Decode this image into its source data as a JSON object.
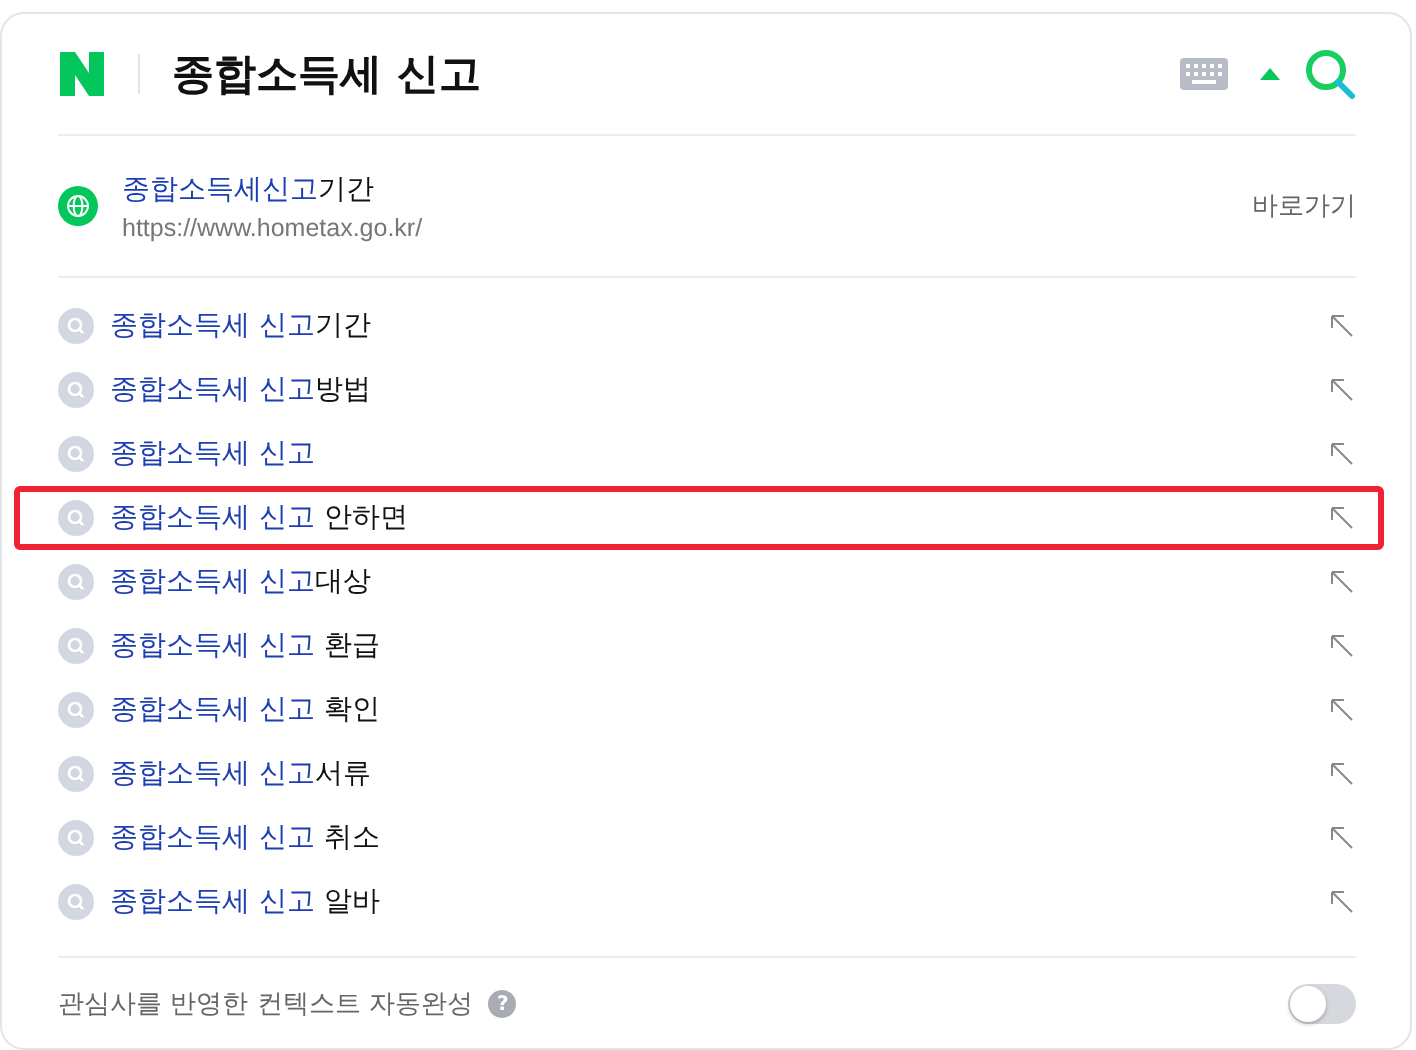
{
  "header": {
    "query": "종합소득세 신고"
  },
  "site_result": {
    "highlight": "종합소득세신고",
    "rest": "기간",
    "url": "https://www.hometax.go.kr/",
    "action": "바로가기"
  },
  "suggestions": [
    {
      "highlight": "종합소득세 신고",
      "rest": "기간",
      "marked": false
    },
    {
      "highlight": "종합소득세 신고",
      "rest": "방법",
      "marked": false
    },
    {
      "highlight": "종합소득세 신고",
      "marked": false
    },
    {
      "highlight": "종합소득세 신고",
      "rest": " 안하면",
      "marked": true
    },
    {
      "highlight": "종합소득세 신고",
      "rest": "대상",
      "marked": false
    },
    {
      "highlight": "종합소득세 신고",
      "rest": " 환급",
      "marked": false
    },
    {
      "highlight": "종합소득세 신고",
      "rest": " 확인",
      "marked": false
    },
    {
      "highlight": "종합소득세 신고",
      "rest": "서류",
      "marked": false
    },
    {
      "highlight": "종합소득세 신고",
      "rest": " 취소",
      "marked": false
    },
    {
      "highlight": "종합소득세 신고",
      "rest": " 알바",
      "marked": false
    }
  ],
  "footer": {
    "label": "관심사를 반영한 컨텍스트 자동완성",
    "help": "?",
    "toggle": {
      "on": false
    }
  }
}
